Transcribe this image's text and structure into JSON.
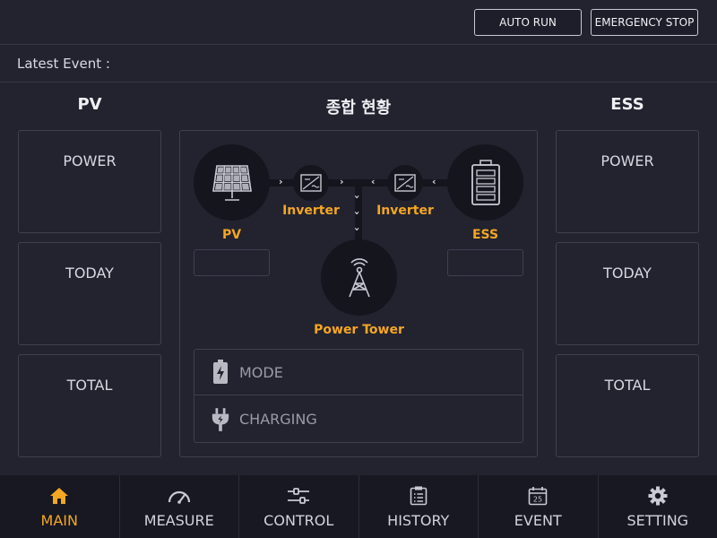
{
  "header": {
    "auto_run_label": "AUTO RUN",
    "emergency_stop_label": "EMERGENCY STOP"
  },
  "event_bar": {
    "label": "Latest Event :"
  },
  "pv_column": {
    "title": "PV",
    "cards": [
      "POWER",
      "TODAY",
      "TOTAL"
    ]
  },
  "ess_column": {
    "title": "ESS",
    "cards": [
      "POWER",
      "TODAY",
      "TOTAL"
    ]
  },
  "overview": {
    "title": "종합 현황",
    "pv_label": "PV",
    "ess_label": "ESS",
    "inverter_left_label": "Inverter",
    "inverter_right_label": "Inverter",
    "tower_label": "Power Tower",
    "mode_label": "MODE",
    "charging_label": "CHARGING",
    "pv_value": "",
    "ess_value": ""
  },
  "nav": {
    "items": [
      {
        "label": "MAIN",
        "icon": "home-icon",
        "active": true
      },
      {
        "label": "MEASURE",
        "icon": "gauge-icon",
        "active": false
      },
      {
        "label": "CONTROL",
        "icon": "sliders-icon",
        "active": false
      },
      {
        "label": "HISTORY",
        "icon": "clipboard-list-icon",
        "active": false
      },
      {
        "label": "EVENT",
        "icon": "calendar-icon",
        "calendar_day": "25",
        "active": false
      },
      {
        "label": "SETTING",
        "icon": "gear-icon",
        "active": false
      }
    ]
  },
  "colors": {
    "background": "#22232f",
    "accent": "#f5a623",
    "node_fill": "#14151d",
    "border": "#3e404f"
  }
}
